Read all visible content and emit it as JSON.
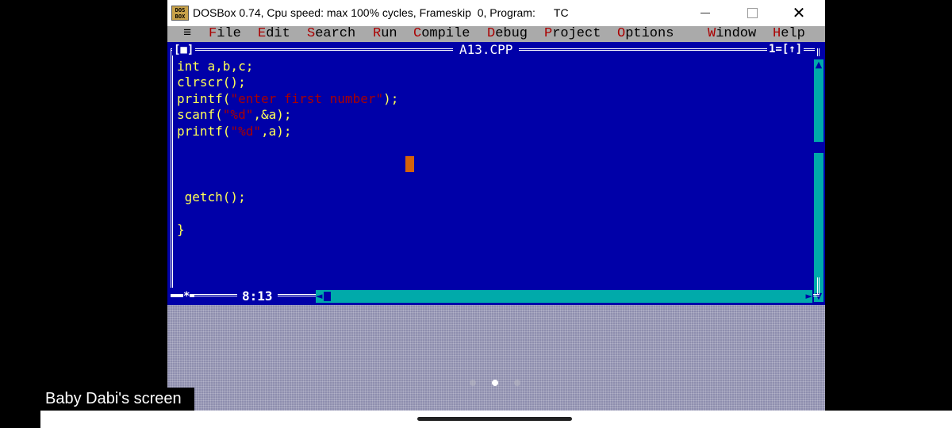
{
  "window": {
    "title": "DOSBox 0.74, Cpu speed: max 100% cycles, Frameskip  0, Program:      TC",
    "icon_text": "DOS BOX",
    "controls": [
      "minimize-icon",
      "maximize-icon",
      "close-icon"
    ],
    "close_glyph": "✕"
  },
  "menu": {
    "system_glyph": "≡",
    "items": [
      {
        "hot": "F",
        "rest": "ile"
      },
      {
        "hot": "E",
        "rest": "dit"
      },
      {
        "hot": "S",
        "rest": "earch"
      },
      {
        "hot": "R",
        "rest": "un"
      },
      {
        "hot": "C",
        "rest": "ompile"
      },
      {
        "hot": "D",
        "rest": "ebug"
      },
      {
        "hot": "P",
        "rest": "roject"
      },
      {
        "hot": "O",
        "rest": "ptions"
      },
      {
        "hot": "W",
        "rest": "indow"
      },
      {
        "hot": "H",
        "rest": "elp"
      }
    ]
  },
  "editor": {
    "close_box": "[■]",
    "filename": "A13.CPP",
    "window_number": "1=[↑]",
    "lines": [
      {
        "pre": "int a,b,c;",
        "str": "",
        "post": ""
      },
      {
        "pre": "clrscr();",
        "str": "",
        "post": ""
      },
      {
        "pre": "printf(",
        "str": "\"enter first number\"",
        "post": ");"
      },
      {
        "pre": "scanf(",
        "str": "\"%d\"",
        "post": ",&a);"
      },
      {
        "pre": "printf(",
        "str": "\"%d\"",
        "post": ",a);"
      },
      {
        "pre": " getch();",
        "str": "",
        "post": ""
      },
      {
        "pre": "}",
        "str": "",
        "post": ""
      }
    ],
    "cursor_position": "8:13",
    "modified_marker": "*",
    "scroll_up_glyph": "▲",
    "scroll_down_glyph": "▼",
    "scroll_left_glyph": "◄",
    "scroll_right_glyph": "►"
  },
  "overlay": {
    "caption": "Baby Dabi's screen",
    "page_dots": 3,
    "active_dot": 1
  },
  "colors": {
    "dos_blue": "#0000a8",
    "dos_gray": "#aaaaaa",
    "dos_cyan": "#00aaaa",
    "code_yellow": "#ffff55",
    "string_red": "#aa0000",
    "cursor_orange": "#d4620a"
  }
}
